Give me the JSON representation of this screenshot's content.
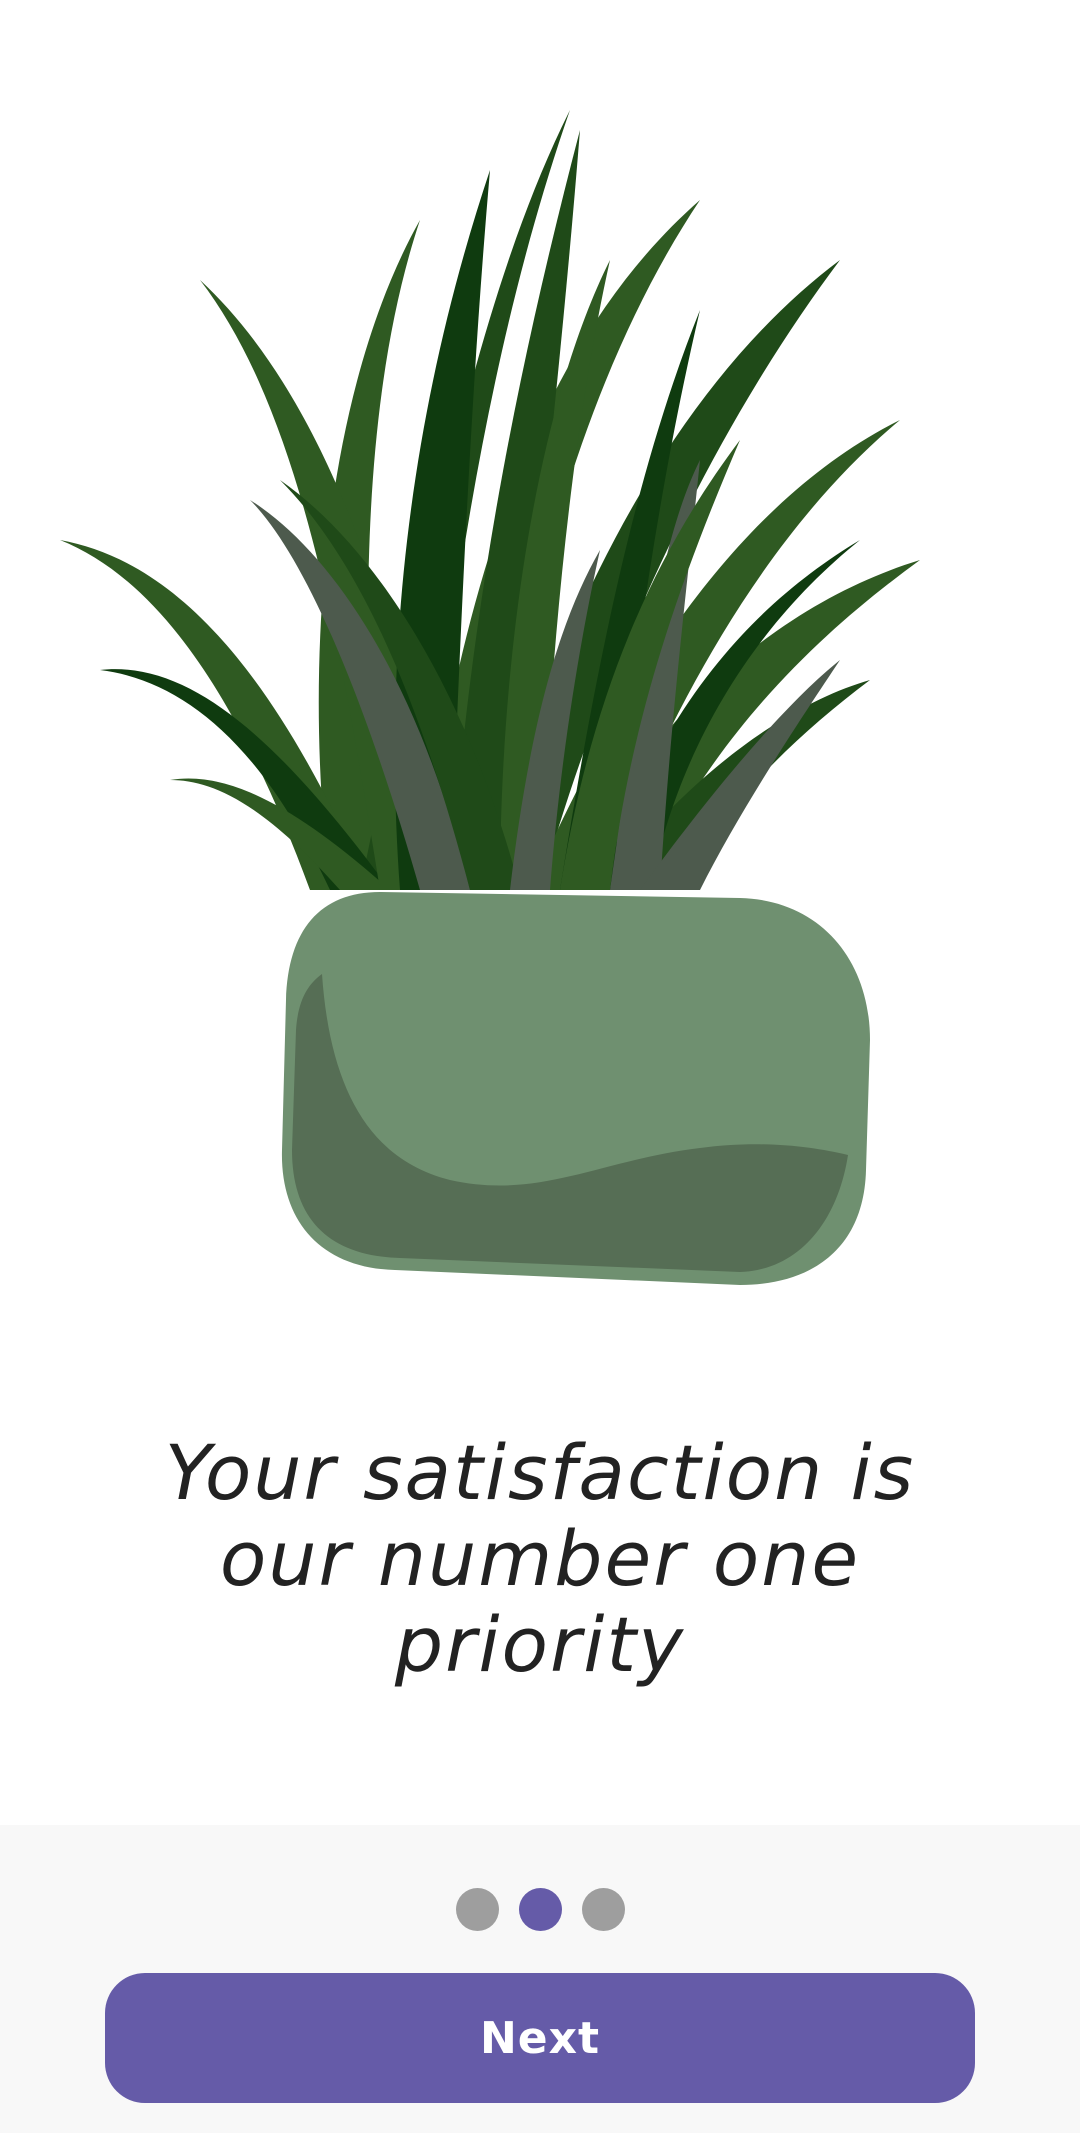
{
  "onboarding": {
    "headline": "Your satisfaction is our number one priority",
    "illustration_icon": "potted-grass-plant",
    "colors": {
      "accent": "#655ba8",
      "inactive_dot": "#9e9e9e",
      "pot": "#6f9070",
      "pot_shadow": "#566e55",
      "leaf_dark": "#0f3b0f",
      "leaf_mid": "#2f5a22",
      "leaf_grey": "#4d5a4d"
    }
  },
  "pager": {
    "total_pages": 3,
    "current_page": 2
  },
  "footer": {
    "next_label": "Next"
  }
}
